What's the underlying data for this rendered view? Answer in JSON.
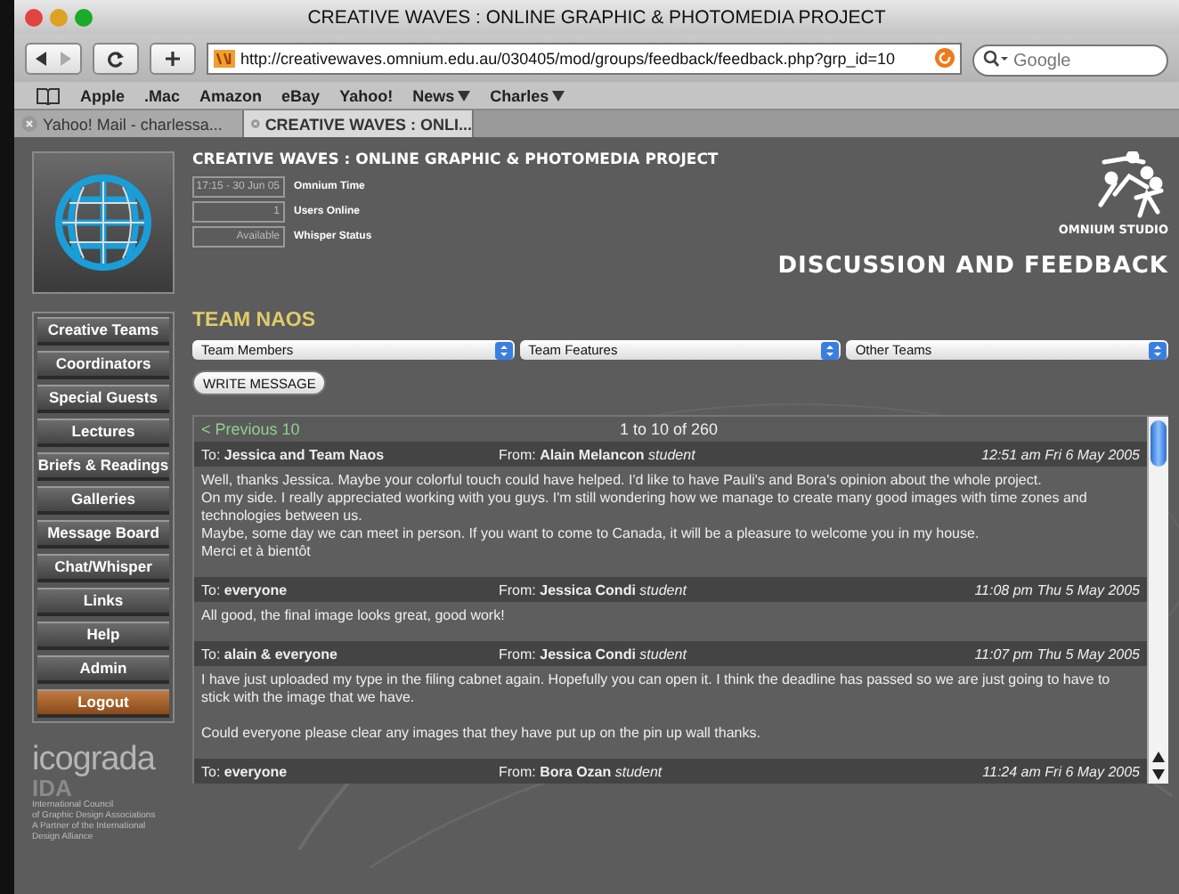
{
  "browser": {
    "title": "CREATIVE WAVES : ONLINE GRAPHIC & PHOTOMEDIA PROJECT",
    "url": "http://creativewaves.omnium.edu.au/030405/mod/groups/feedback/feedback.php?grp_id=10",
    "search": {
      "placeholder": "Google"
    },
    "bookmarks": [
      {
        "label": "Apple",
        "menu": false
      },
      {
        "label": ".Mac",
        "menu": false
      },
      {
        "label": "Amazon",
        "menu": false
      },
      {
        "label": "eBay",
        "menu": false
      },
      {
        "label": "Yahoo!",
        "menu": false
      },
      {
        "label": "News",
        "menu": true
      },
      {
        "label": "Charles",
        "menu": true
      }
    ],
    "tabs": [
      {
        "label": "Yahoo! Mail - charlessa...",
        "selected": false
      },
      {
        "label": "CREATIVE WAVES : ONLI...",
        "selected": true
      }
    ]
  },
  "site": {
    "title": "CREATIVE WAVES : ONLINE GRAPHIC & PHOTOMEDIA PROJECT",
    "status": [
      {
        "value": "17:15 - 30 Jun 05",
        "label": "Omnium Time"
      },
      {
        "value": "1",
        "label": "Users Online"
      },
      {
        "value": "Available",
        "label": "Whisper Status"
      }
    ],
    "brand": "OMNIUM STUDIO",
    "section": "DISCUSSION AND FEEDBACK",
    "nav": [
      {
        "label": "Creative Teams",
        "kind": "normal"
      },
      {
        "label": "Coordinators",
        "kind": "normal"
      },
      {
        "label": "Special Guests",
        "kind": "normal"
      },
      {
        "label": "Lectures",
        "kind": "normal"
      },
      {
        "label": "Briefs & Readings",
        "kind": "normal"
      },
      {
        "label": "Galleries",
        "kind": "normal"
      },
      {
        "label": "Message Board",
        "kind": "normal"
      },
      {
        "label": "Chat/Whisper",
        "kind": "normal"
      },
      {
        "label": "Links",
        "kind": "normal"
      },
      {
        "label": "Help",
        "kind": "normal"
      },
      {
        "label": "Admin",
        "kind": "normal"
      },
      {
        "label": "Logout",
        "kind": "logout"
      }
    ],
    "partner": {
      "name": "icograda",
      "sub": "IDA",
      "lines": [
        "International Council",
        "of Graphic Design Associations",
        "A Partner of the International",
        "Design Alliance"
      ]
    },
    "team": "TEAM NAOS",
    "selects": [
      "Team Members",
      "Team Features",
      "Other Teams"
    ],
    "write_button": "WRITE MESSAGE",
    "pager": {
      "previous": "< Previous 10",
      "range": "1 to 10 of 260"
    },
    "messages": [
      {
        "to_label": "To:",
        "to": "Jessica and Team Naos",
        "from_label": "From:",
        "from": "Alain Melancon",
        "role": "student",
        "time": "12:51 am Fri 6 May 2005",
        "paragraphs": [
          [
            "Well, thanks Jessica. Maybe your colorful touch could have helped. I'd like to have Pauli's and Bora's opinion about the whole project.",
            "On my side. I really appreciated working with you guys. I'm still wondering how we manage to create many good images with time zones and technologies between us.",
            "Maybe, some day we can meet in person. If you want to come to Canada, it will be a pleasure to welcome you in my house.",
            "Merci et à bientôt"
          ]
        ]
      },
      {
        "to_label": "To:",
        "to": "everyone",
        "from_label": "From:",
        "from": "Jessica Condi",
        "role": "student",
        "time": "11:08 pm Thu 5 May 2005",
        "paragraphs": [
          [
            "All good, the final image looks great, good work!"
          ]
        ]
      },
      {
        "to_label": "To:",
        "to": "alain & everyone",
        "from_label": "From:",
        "from": "Jessica Condi",
        "role": "student",
        "time": "11:07 pm Thu 5 May 2005",
        "paragraphs": [
          [
            "I have just uploaded my type in the filing cabnet again. Hopefully you can open it. I think the deadline has passed so we are just going to have to stick with the image that we have."
          ],
          [
            "Could everyone please clear any images that they have put up on the pin up wall thanks."
          ]
        ]
      },
      {
        "to_label": "To:",
        "to": "everyone",
        "from_label": "From:",
        "from": "Bora Ozan",
        "role": "student",
        "time": "11:24 am Fri 6 May 2005"
      }
    ]
  }
}
